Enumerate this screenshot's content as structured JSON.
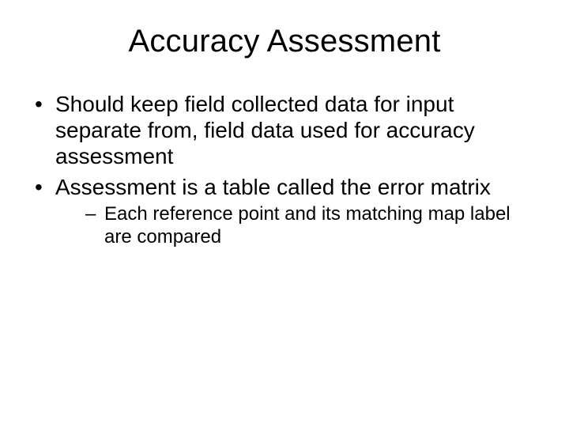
{
  "title": "Accuracy Assessment",
  "bullets": [
    "Should keep field collected data for input separate from, field data used for accuracy assessment",
    "Assessment is a table called the error matrix"
  ],
  "sub_bullets": [
    "Each reference point and its matching map label are compared"
  ]
}
